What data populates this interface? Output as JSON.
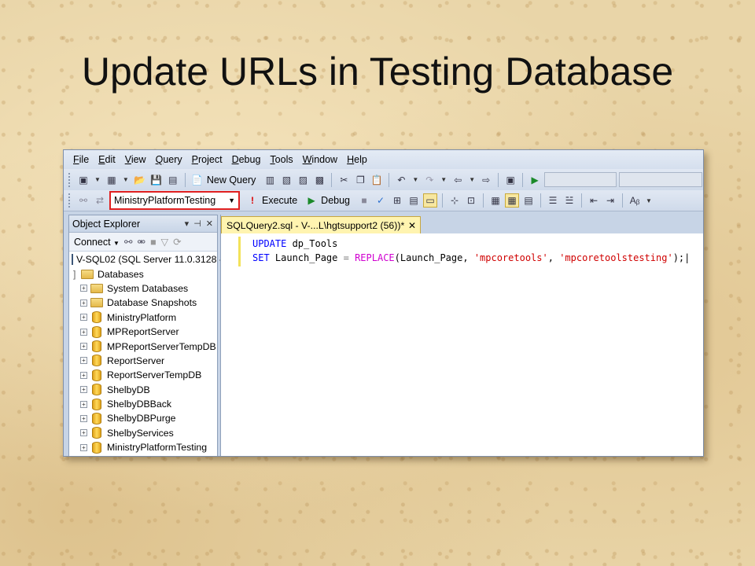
{
  "slide": {
    "title": "Update URLs in Testing Database"
  },
  "menu": [
    {
      "label": "File",
      "u": "F",
      "rest": "ile"
    },
    {
      "label": "Edit",
      "u": "E",
      "rest": "dit"
    },
    {
      "label": "View",
      "u": "V",
      "rest": "iew"
    },
    {
      "label": "Query",
      "u": "Q",
      "rest": "uery"
    },
    {
      "label": "Project",
      "u": "P",
      "rest": "roject"
    },
    {
      "label": "Debug",
      "u": "D",
      "rest": "ebug"
    },
    {
      "label": "Tools",
      "u": "T",
      "rest": "ools"
    },
    {
      "label": "Window",
      "u": "W",
      "rest": "indow"
    },
    {
      "label": "Help",
      "u": "H",
      "rest": "elp"
    }
  ],
  "toolbar": {
    "new_query": "New Query",
    "database": "MinistryPlatformTesting",
    "execute": "Execute",
    "debug": "Debug"
  },
  "object_explorer": {
    "title": "Object Explorer",
    "connect": "Connect",
    "server": "V-SQL02 (SQL Server 11.0.3128 -",
    "databases_folder": "Databases",
    "items": [
      {
        "label": "System Databases",
        "kind": "folder"
      },
      {
        "label": "Database Snapshots",
        "kind": "folder"
      },
      {
        "label": "MinistryPlatform",
        "kind": "db"
      },
      {
        "label": "MPReportServer",
        "kind": "db"
      },
      {
        "label": "MPReportServerTempDB",
        "kind": "db"
      },
      {
        "label": "ReportServer",
        "kind": "db"
      },
      {
        "label": "ReportServerTempDB",
        "kind": "db"
      },
      {
        "label": "ShelbyDB",
        "kind": "db"
      },
      {
        "label": "ShelbyDBBack",
        "kind": "db"
      },
      {
        "label": "ShelbyDBPurge",
        "kind": "db"
      },
      {
        "label": "ShelbyServices",
        "kind": "db"
      },
      {
        "label": "MinistryPlatformTesting",
        "kind": "db"
      }
    ]
  },
  "editor": {
    "tab_label": "SQLQuery2.sql - V-...L\\hgtsupport2 (56))*",
    "line1": {
      "kw": "UPDATE",
      "rest": " dp_Tools"
    },
    "line2": {
      "kw": "SET",
      "mid": " Launch_Page ",
      "eq": "=",
      "fn": "REPLACE",
      "args_open": "(Launch_Page, ",
      "str1": "'mpcoretools'",
      "comma": ", ",
      "str2": "'mpcoretoolstesting'",
      "close": ");"
    }
  },
  "colors": {
    "highlight_border": "#e02020",
    "tab_active": "#fff4b0"
  }
}
